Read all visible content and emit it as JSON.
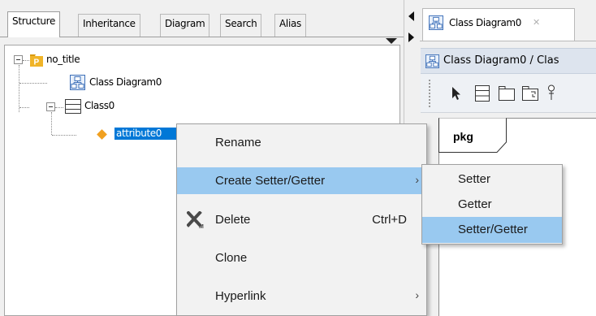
{
  "left_tabs": [
    {
      "label": "Structure",
      "active": true
    },
    {
      "label": "Inheritance",
      "active": false
    },
    {
      "label": "Diagram",
      "active": false
    },
    {
      "label": "Search",
      "active": false
    },
    {
      "label": "Alias",
      "active": false
    }
  ],
  "tree": {
    "root": {
      "label": "no_title",
      "icon": "package-icon"
    },
    "diagram": {
      "label": "Class Diagram0",
      "icon": "class-diagram-icon"
    },
    "class": {
      "label": "Class0",
      "icon": "class-icon"
    },
    "attribute": {
      "label": "attribute0",
      "icon": "attribute-icon",
      "selected": true
    }
  },
  "doc_tab": {
    "label": "Class Diagram0",
    "close": "✕"
  },
  "editor": {
    "title": "Class Diagram0 / Clas",
    "frame_label": "pkg"
  },
  "toolbar": {
    "tools": [
      "select-tool",
      "class-tool",
      "package-tool",
      "subsystem-tool",
      "pin-tool"
    ]
  },
  "context_menu": {
    "items": [
      {
        "label": "Rename",
        "shortcut": "",
        "has_submenu": false,
        "icon": ""
      },
      {
        "label": "Create Setter/Getter",
        "shortcut": "",
        "has_submenu": true,
        "icon": "",
        "highlighted": true
      },
      {
        "label": "Delete",
        "shortcut": "Ctrl+D",
        "has_submenu": false,
        "icon": "delete-x-icon"
      },
      {
        "label": "Clone",
        "shortcut": "",
        "has_submenu": false,
        "icon": ""
      },
      {
        "label": "Hyperlink",
        "shortcut": "",
        "has_submenu": true,
        "icon": ""
      }
    ]
  },
  "submenu": {
    "items": [
      {
        "label": "Setter",
        "highlighted": false
      },
      {
        "label": "Getter",
        "highlighted": false
      },
      {
        "label": "Setter/Getter",
        "highlighted": true
      }
    ]
  },
  "colors": {
    "selection": "#0078d7",
    "menu_highlight": "#99c9f0",
    "package_icon": "#f0b428"
  }
}
